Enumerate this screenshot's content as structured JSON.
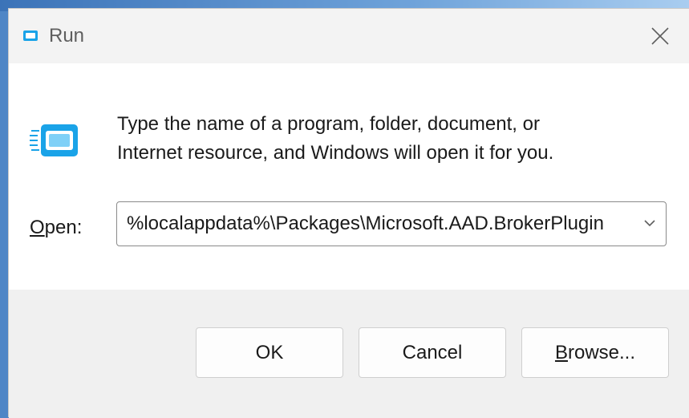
{
  "window": {
    "title": "Run",
    "icon": "run-icon",
    "close_icon": "close-icon"
  },
  "dialog": {
    "description_line1": "Type the name of a program, folder, document, or",
    "description_line2": "Internet resource, and Windows will open it for you.",
    "open_label_accel": "O",
    "open_label_rest": "pen:",
    "open_value": "%localappdata%\\Packages\\Microsoft.AAD.BrokerPlugin",
    "dropdown_icon": "chevron-down-icon"
  },
  "buttons": {
    "ok": "OK",
    "cancel": "Cancel",
    "browse_accel": "B",
    "browse_rest": "rowse..."
  },
  "colors": {
    "accent": "#1aa3e8",
    "background": "#ffffff",
    "footer": "#f0f0f0"
  }
}
